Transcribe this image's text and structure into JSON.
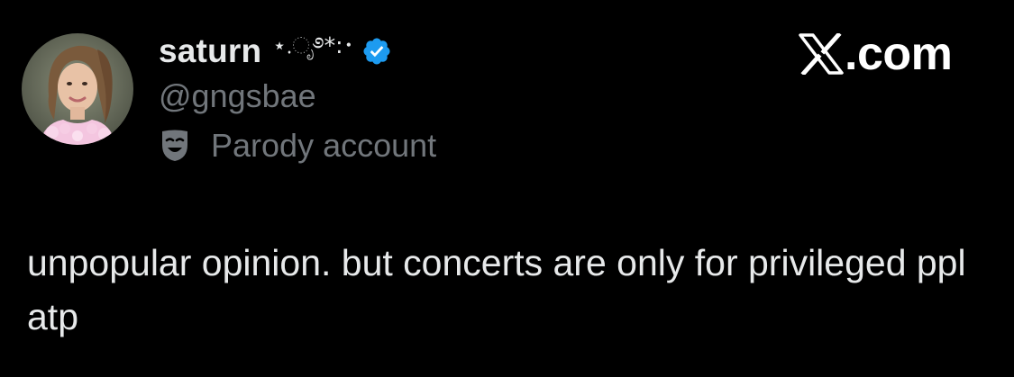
{
  "colors": {
    "background": "#000000",
    "primary_text": "#e7e9ea",
    "secondary_text": "#71767b",
    "verified_blue": "#1d9bf0"
  },
  "author": {
    "display_name": "saturn",
    "name_decoration": "⋆.ೃ࿔*:･",
    "handle": "@gngsbae",
    "verified": true,
    "verified_icon": "verified-badge-icon",
    "avatar_icon": "avatar-photo"
  },
  "parody": {
    "icon": "theater-mask-icon",
    "label": "Parody account"
  },
  "brand": {
    "logo_icon": "x-logo-icon",
    "logo_letter": "X",
    "suffix": ".com"
  },
  "tweet": {
    "text": "unpopular opinion. but concerts are only for privileged ppl atp"
  }
}
